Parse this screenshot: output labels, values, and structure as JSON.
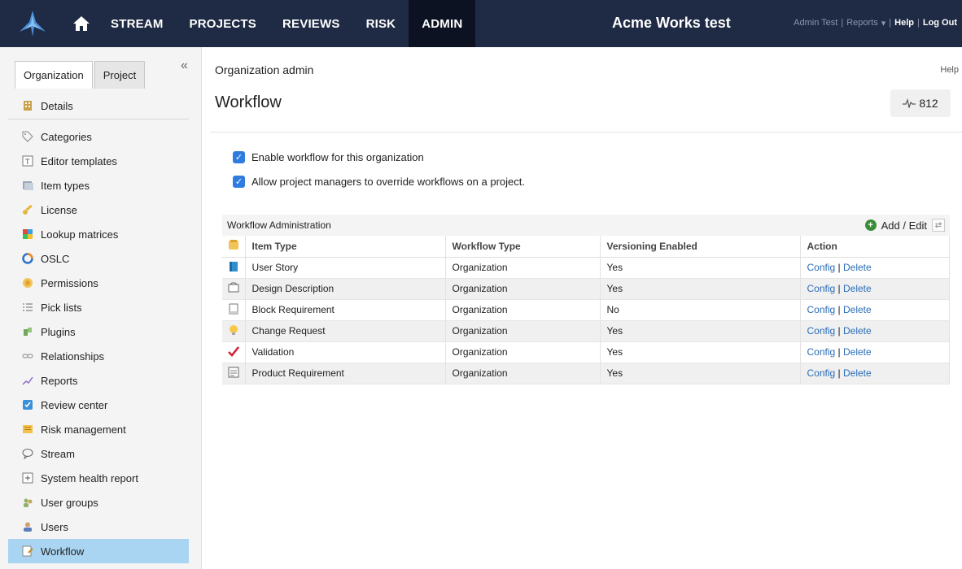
{
  "topbar": {
    "nav": [
      "STREAM",
      "PROJECTS",
      "REVIEWS",
      "RISK",
      "ADMIN"
    ],
    "active_nav": "ADMIN",
    "app_title": "Acme Works test",
    "user": "Admin Test",
    "sep1": "|",
    "reports": "Reports",
    "reports_caret": "▾",
    "sep2": "|",
    "help": "Help",
    "sep3": "|",
    "logout": "Log Out"
  },
  "sidebar": {
    "tabs": [
      "Organization",
      "Project"
    ],
    "active_tab": "Organization",
    "collapse_glyph": "«",
    "items": [
      {
        "label": "Details",
        "icon": "building-icon"
      },
      {
        "label": "Categories",
        "icon": "tag-icon"
      },
      {
        "label": "Editor templates",
        "icon": "template-icon"
      },
      {
        "label": "Item types",
        "icon": "item-types-icon"
      },
      {
        "label": "License",
        "icon": "key-icon"
      },
      {
        "label": "Lookup matrices",
        "icon": "matrix-icon"
      },
      {
        "label": "OSLC",
        "icon": "oslc-icon"
      },
      {
        "label": "Permissions",
        "icon": "permissions-icon"
      },
      {
        "label": "Pick lists",
        "icon": "list-icon"
      },
      {
        "label": "Plugins",
        "icon": "plugin-icon"
      },
      {
        "label": "Relationships",
        "icon": "link-icon"
      },
      {
        "label": "Reports",
        "icon": "chart-icon"
      },
      {
        "label": "Review center",
        "icon": "review-icon"
      },
      {
        "label": "Risk management",
        "icon": "risk-icon"
      },
      {
        "label": "Stream",
        "icon": "chat-icon"
      },
      {
        "label": "System health report",
        "icon": "health-icon"
      },
      {
        "label": "User groups",
        "icon": "group-icon"
      },
      {
        "label": "Users",
        "icon": "user-icon"
      },
      {
        "label": "Workflow",
        "icon": "workflow-icon"
      }
    ],
    "selected": "Workflow"
  },
  "main": {
    "breadcrumb": "Organization admin",
    "help": "Help",
    "title": "Workflow",
    "pulse_count": "812",
    "options": [
      {
        "label": "Enable workflow for this organization",
        "checked": true
      },
      {
        "label": "Allow project managers to override workflows on a project.",
        "checked": true
      }
    ],
    "panel": {
      "title": "Workflow Administration",
      "add_edit": "Add / Edit",
      "columns": [
        "Item Type",
        "Workflow Type",
        "Versioning Enabled",
        "Action"
      ],
      "rows": [
        {
          "icon": "user-story-icon",
          "item_type": "User Story",
          "workflow_type": "Organization",
          "versioning": "Yes",
          "config": "Config",
          "sep": "|",
          "delete": "Delete"
        },
        {
          "icon": "design-description-icon",
          "item_type": "Design Description",
          "workflow_type": "Organization",
          "versioning": "Yes",
          "config": "Config",
          "sep": "|",
          "delete": "Delete"
        },
        {
          "icon": "block-requirement-icon",
          "item_type": "Block Requirement",
          "workflow_type": "Organization",
          "versioning": "No",
          "config": "Config",
          "sep": "|",
          "delete": "Delete"
        },
        {
          "icon": "change-request-icon",
          "item_type": "Change Request",
          "workflow_type": "Organization",
          "versioning": "Yes",
          "config": "Config",
          "sep": "|",
          "delete": "Delete"
        },
        {
          "icon": "validation-icon",
          "item_type": "Validation",
          "workflow_type": "Organization",
          "versioning": "Yes",
          "config": "Config",
          "sep": "|",
          "delete": "Delete"
        },
        {
          "icon": "product-requirement-icon",
          "item_type": "Product Requirement",
          "workflow_type": "Organization",
          "versioning": "Yes",
          "config": "Config",
          "sep": "|",
          "delete": "Delete"
        }
      ]
    }
  }
}
